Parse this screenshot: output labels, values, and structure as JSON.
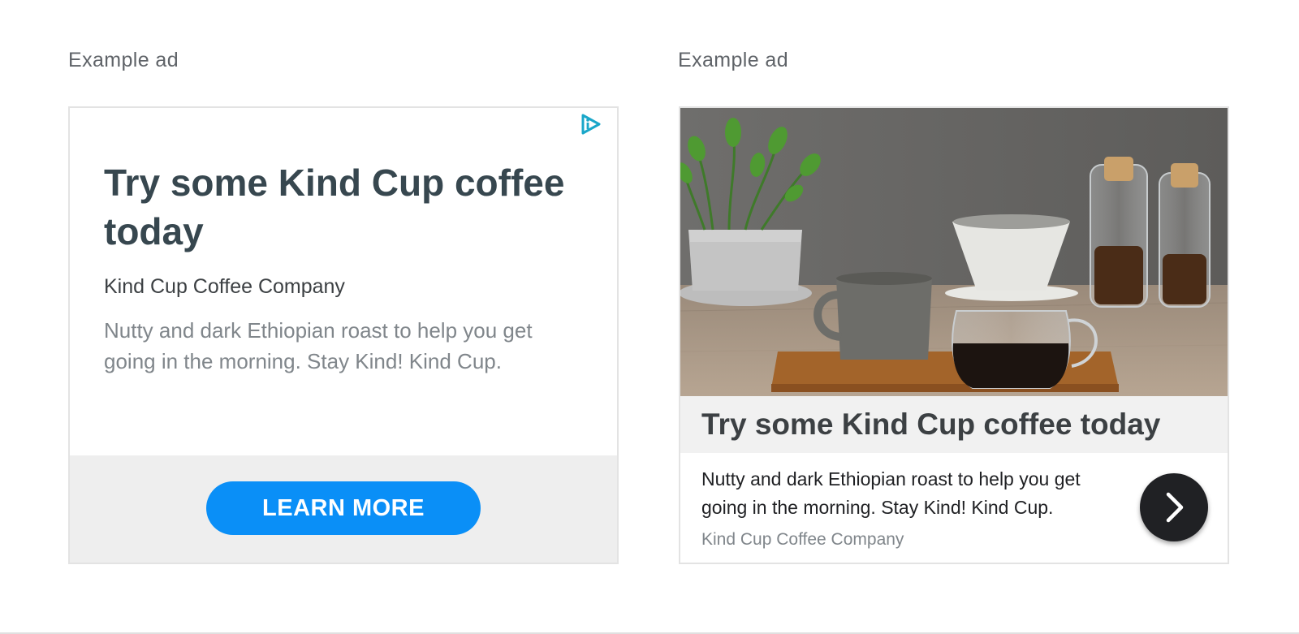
{
  "captions": [
    "Example ad",
    "Example ad"
  ],
  "ad_text": {
    "headline": "Try some Kind Cup coffee today",
    "advertiser": "Kind Cup Coffee Company",
    "description": "Nutty and dark Ethiopian roast to help you get going in the morning. Stay Kind! Kind Cup.",
    "cta_label": "LEARN MORE"
  },
  "icons": {
    "adchoices": "adchoices-icon",
    "next": "chevron-right-icon"
  },
  "colors": {
    "cta_blue": "#0a8ff7",
    "adchoices_teal": "#1aa7c9",
    "headline_slate": "#37474f",
    "next_button": "#202124"
  }
}
